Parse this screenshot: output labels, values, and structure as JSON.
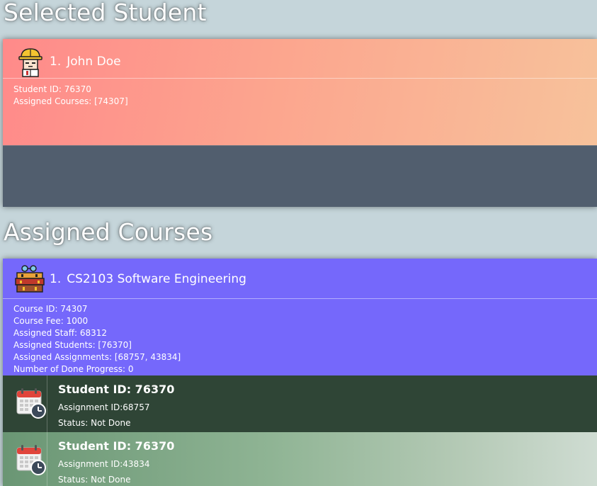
{
  "sections": {
    "selected_student_title": "Selected Student",
    "assigned_courses_title": "Assigned Courses"
  },
  "student": {
    "index": "1.",
    "name": "John Doe",
    "id_line": "Student ID: 76370",
    "courses_line": "Assigned Courses: [74307]",
    "avatar_icon": "student-avatar-icon"
  },
  "course": {
    "index": "1.",
    "name": "CS2103 Software Engineering",
    "icon": "books-icon",
    "details": [
      "Course ID: 74307",
      "Course Fee: 1000",
      "Assigned Staff: 68312",
      "Assigned Students: [76370]",
      "Assigned Assignments: [68757, 43834]",
      "Number of Done Progress: 0"
    ]
  },
  "progress": [
    {
      "title": "Student ID: 76370",
      "assignment": "Assignment ID:68757",
      "status": "Status: Not Done",
      "icon": "calendar-icon"
    },
    {
      "title": "Student ID: 76370",
      "assignment": "Assignment ID:43834",
      "status": "Status: Not Done",
      "icon": "calendar-icon"
    }
  ],
  "colors": {
    "background": "#c5d5da",
    "student_gradient_start": "#ff8a8a",
    "student_gradient_end": "#f7c29b",
    "student_footer": "#515e6e",
    "course_card": "#7568fb",
    "progress_dark": "#2f4536",
    "progress_light": "#8fb494"
  }
}
